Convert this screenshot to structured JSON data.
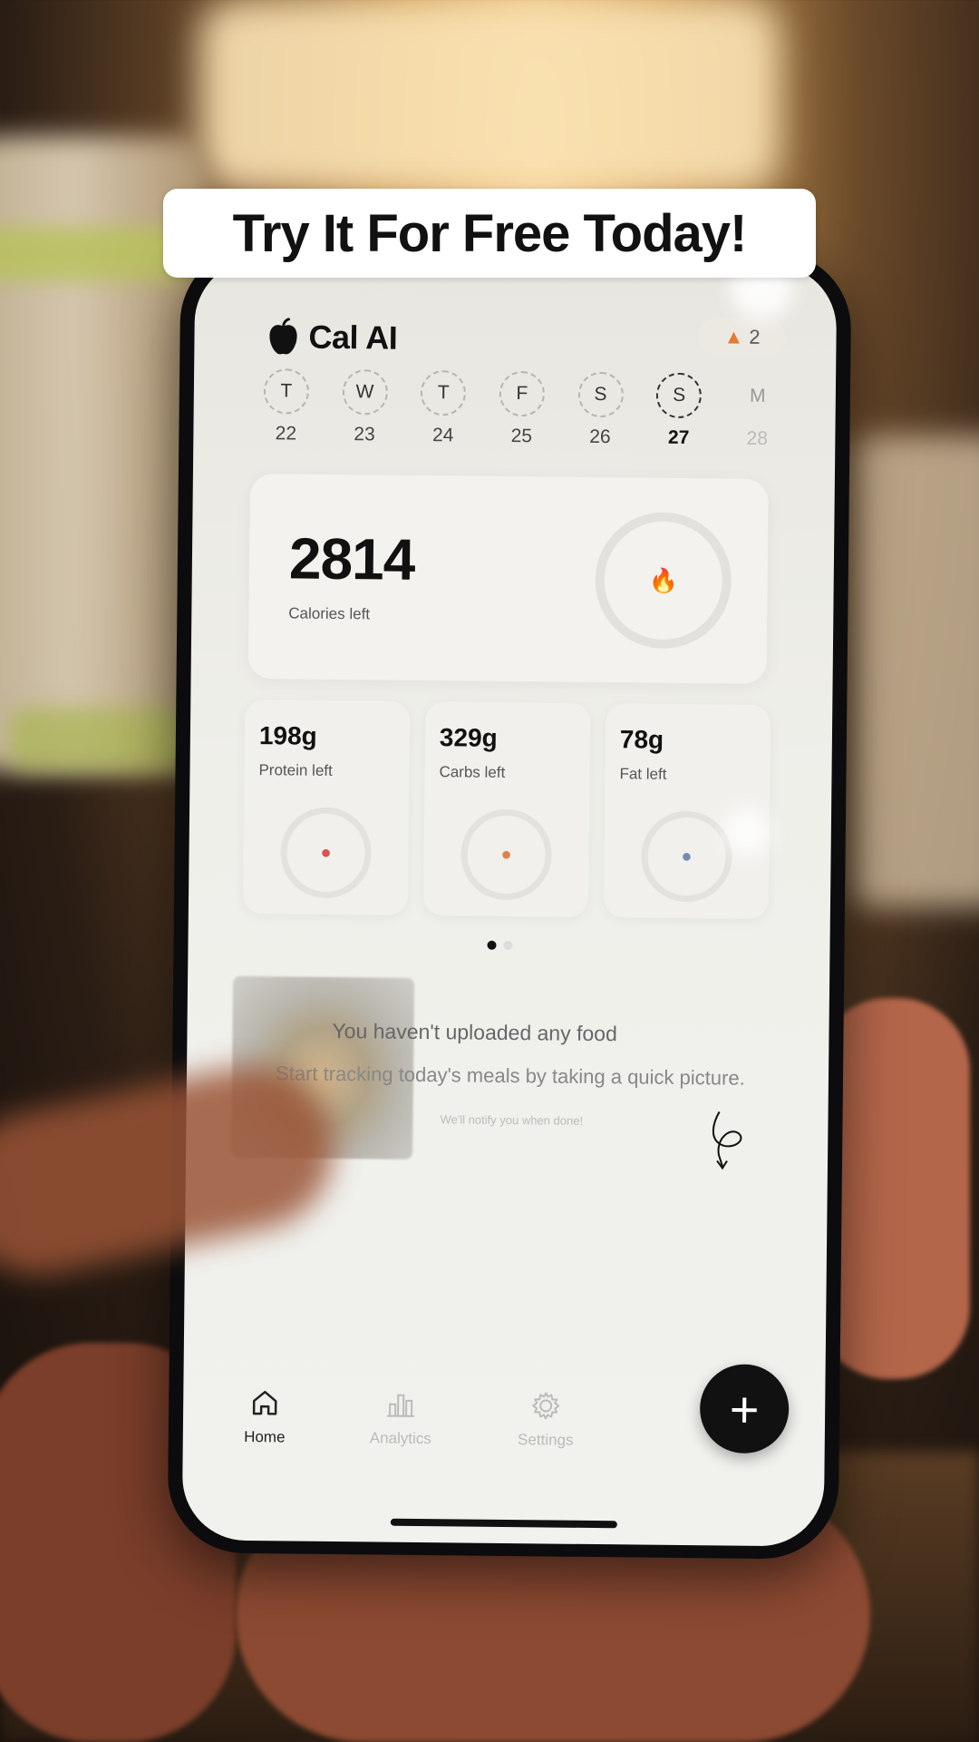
{
  "banner": {
    "text": "Try It For Free Today!"
  },
  "app": {
    "name": "Cal AI",
    "streak_count": "2"
  },
  "days": [
    {
      "letter": "T",
      "num": "22",
      "state": "past"
    },
    {
      "letter": "W",
      "num": "23",
      "state": "past"
    },
    {
      "letter": "T",
      "num": "24",
      "state": "past"
    },
    {
      "letter": "F",
      "num": "25",
      "state": "past"
    },
    {
      "letter": "S",
      "num": "26",
      "state": "past"
    },
    {
      "letter": "S",
      "num": "27",
      "state": "today"
    },
    {
      "letter": "M",
      "num": "28",
      "state": "future"
    }
  ],
  "calories": {
    "value": "2814",
    "label": "Calories left"
  },
  "macros": [
    {
      "value": "198g",
      "label": "Protein left",
      "icon": "drumstick-icon"
    },
    {
      "value": "329g",
      "label": "Carbs left",
      "icon": "wheat-icon"
    },
    {
      "value": "78g",
      "label": "Fat left",
      "icon": "droplet-icon"
    }
  ],
  "empty_state": {
    "title": "You haven't uploaded any food",
    "subtitle": "Start tracking today's meals by taking a quick picture.",
    "note": "We'll notify you when done!"
  },
  "tabs": [
    {
      "label": "Home",
      "icon": "home-icon",
      "active": true
    },
    {
      "label": "Analytics",
      "icon": "bar-chart-icon",
      "active": false
    },
    {
      "label": "Settings",
      "icon": "gear-icon",
      "active": false
    }
  ],
  "fab": {
    "label": "+"
  },
  "colors": {
    "accent": "#111111",
    "protein": "#d9534f",
    "carbs": "#d9844a",
    "fat": "#6f8db6",
    "streak": "#e57b2e"
  }
}
